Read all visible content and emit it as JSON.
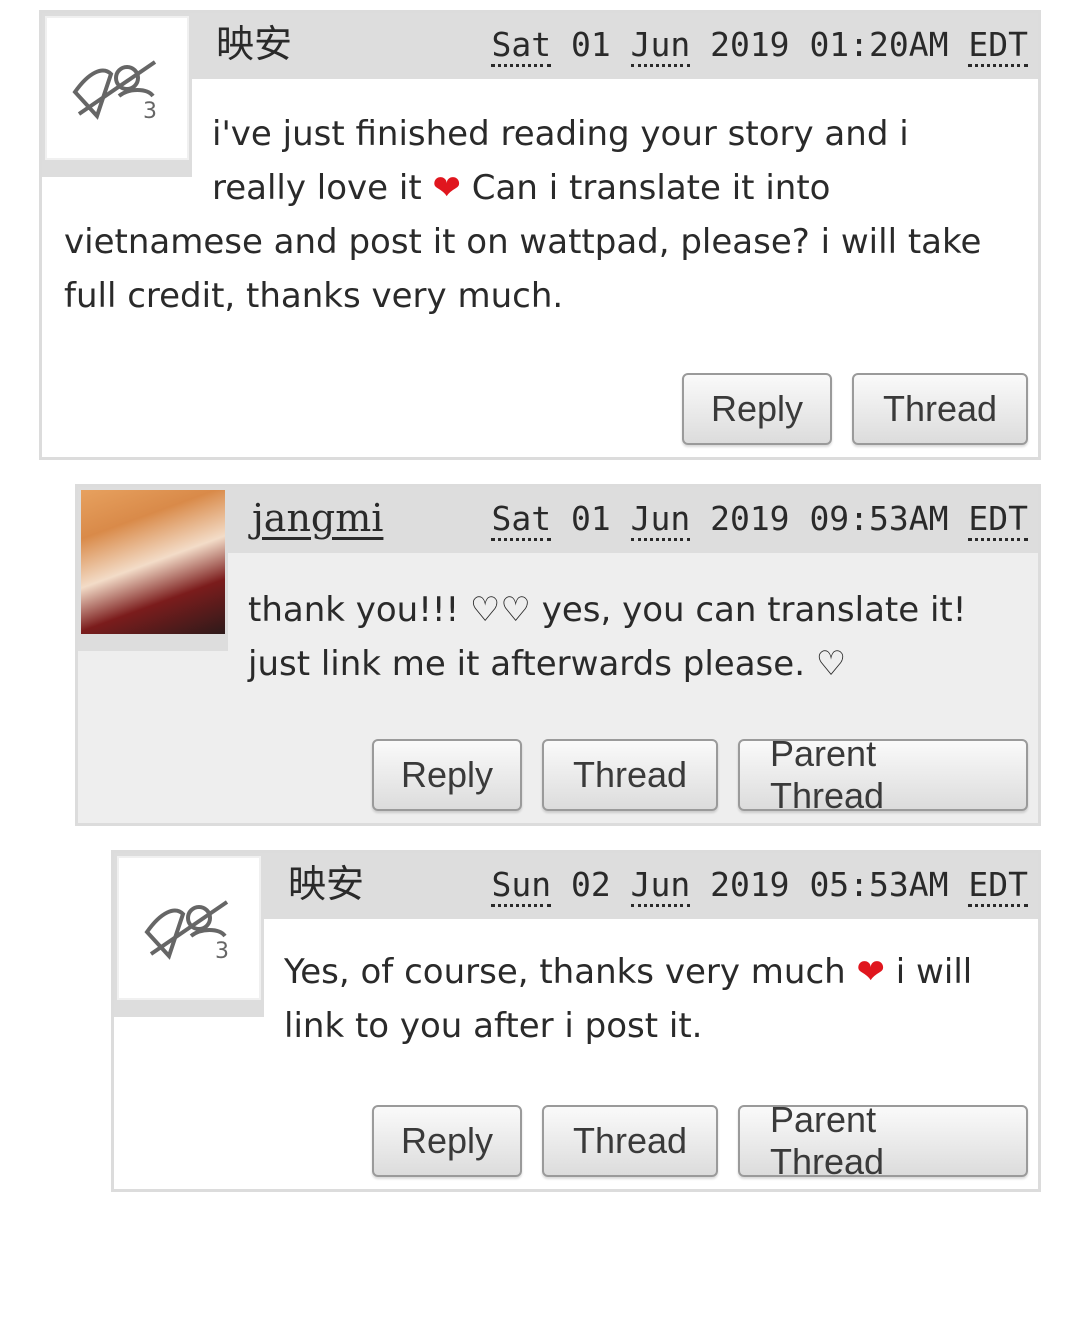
{
  "comments": [
    {
      "author": "映安",
      "date": {
        "day": "Sat",
        "num": "01",
        "month": "Jun",
        "year": "2019",
        "time": "01:20AM",
        "tz": "EDT"
      },
      "body": "i've just finished reading your story and i really love it ❤ Can i translate it into vietnamese and post it on wattpad, please? i will take full credit, thanks very much.",
      "buttons": [
        "Reply",
        "Thread"
      ]
    },
    {
      "author": "jangmi",
      "date": {
        "day": "Sat",
        "num": "01",
        "month": "Jun",
        "year": "2019",
        "time": "09:53AM",
        "tz": "EDT"
      },
      "body": "thank you!!! ♡♡ yes, you can translate it! just link me it afterwards please. ♡",
      "buttons": [
        "Reply",
        "Thread",
        "Parent Thread"
      ]
    },
    {
      "author": "映安",
      "date": {
        "day": "Sun",
        "num": "02",
        "month": "Jun",
        "year": "2019",
        "time": "05:53AM",
        "tz": "EDT"
      },
      "body": "Yes, of course, thanks very much ❤ i will link to you after i post it.",
      "buttons": [
        "Reply",
        "Thread",
        "Parent Thread"
      ]
    }
  ],
  "icons": {
    "default_avatar": "default-avatar-icon",
    "heart": "heart-icon"
  },
  "colors": {
    "heart": "#e0161e",
    "header_bg": "#dddddd",
    "reply_bg": "#eeeeee"
  }
}
